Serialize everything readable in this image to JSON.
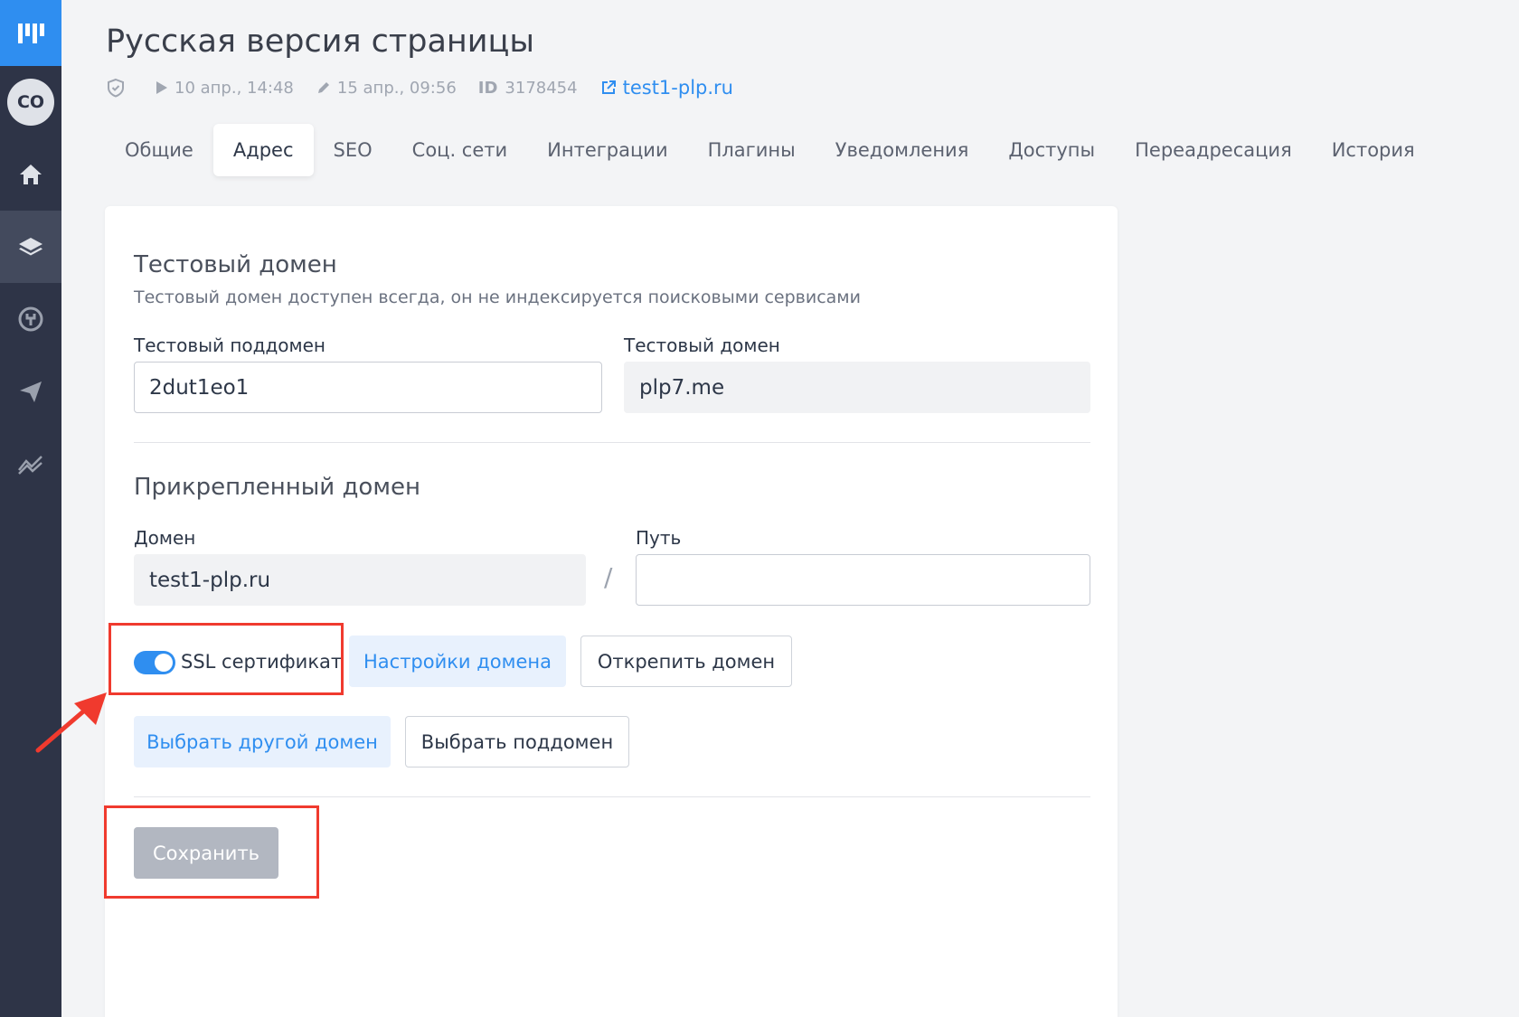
{
  "header": {
    "title": "Русская версия страницы",
    "published": "10 апр., 14:48",
    "edited": "15 апр., 09:56",
    "id_label": "ID",
    "id_value": "3178454",
    "domain_link": "test1-plp.ru"
  },
  "sidebar": {
    "avatar_initials": "CO",
    "items": [
      {
        "icon": "home-icon"
      },
      {
        "icon": "layers-icon",
        "active": true
      },
      {
        "icon": "plug-icon"
      },
      {
        "icon": "send-icon"
      },
      {
        "icon": "analytics-icon"
      }
    ]
  },
  "tabs": [
    {
      "label": "Общие"
    },
    {
      "label": "Адрес",
      "active": true
    },
    {
      "label": "SEO"
    },
    {
      "label": "Соц. сети"
    },
    {
      "label": "Интеграции"
    },
    {
      "label": "Плагины"
    },
    {
      "label": "Уведомления"
    },
    {
      "label": "Доступы"
    },
    {
      "label": "Переадресация"
    },
    {
      "label": "История"
    }
  ],
  "test_domain": {
    "title": "Тестовый домен",
    "description": "Тестовый домен доступен всегда, он не индексируется поисковыми сервисами",
    "subdomain_label": "Тестовый поддомен",
    "subdomain_value": "2dut1eo1",
    "domain_label": "Тестовый домен",
    "domain_value": "plp7.me"
  },
  "attached_domain": {
    "title": "Прикрепленный домен",
    "domain_label": "Домен",
    "domain_value": "test1-plp.ru",
    "separator": "/",
    "path_label": "Путь",
    "path_value": "",
    "ssl_label": "SSL сертификат",
    "ssl_enabled": true,
    "settings_button": "Настройки домена",
    "detach_button": "Открепить домен",
    "choose_other_button": "Выбрать другой домен",
    "choose_subdomain_button": "Выбрать поддомен"
  },
  "save_button": "Сохранить",
  "colors": {
    "accent": "#2f8ef0",
    "sidebar": "#2e3447",
    "annotation": "#f03a2e"
  }
}
